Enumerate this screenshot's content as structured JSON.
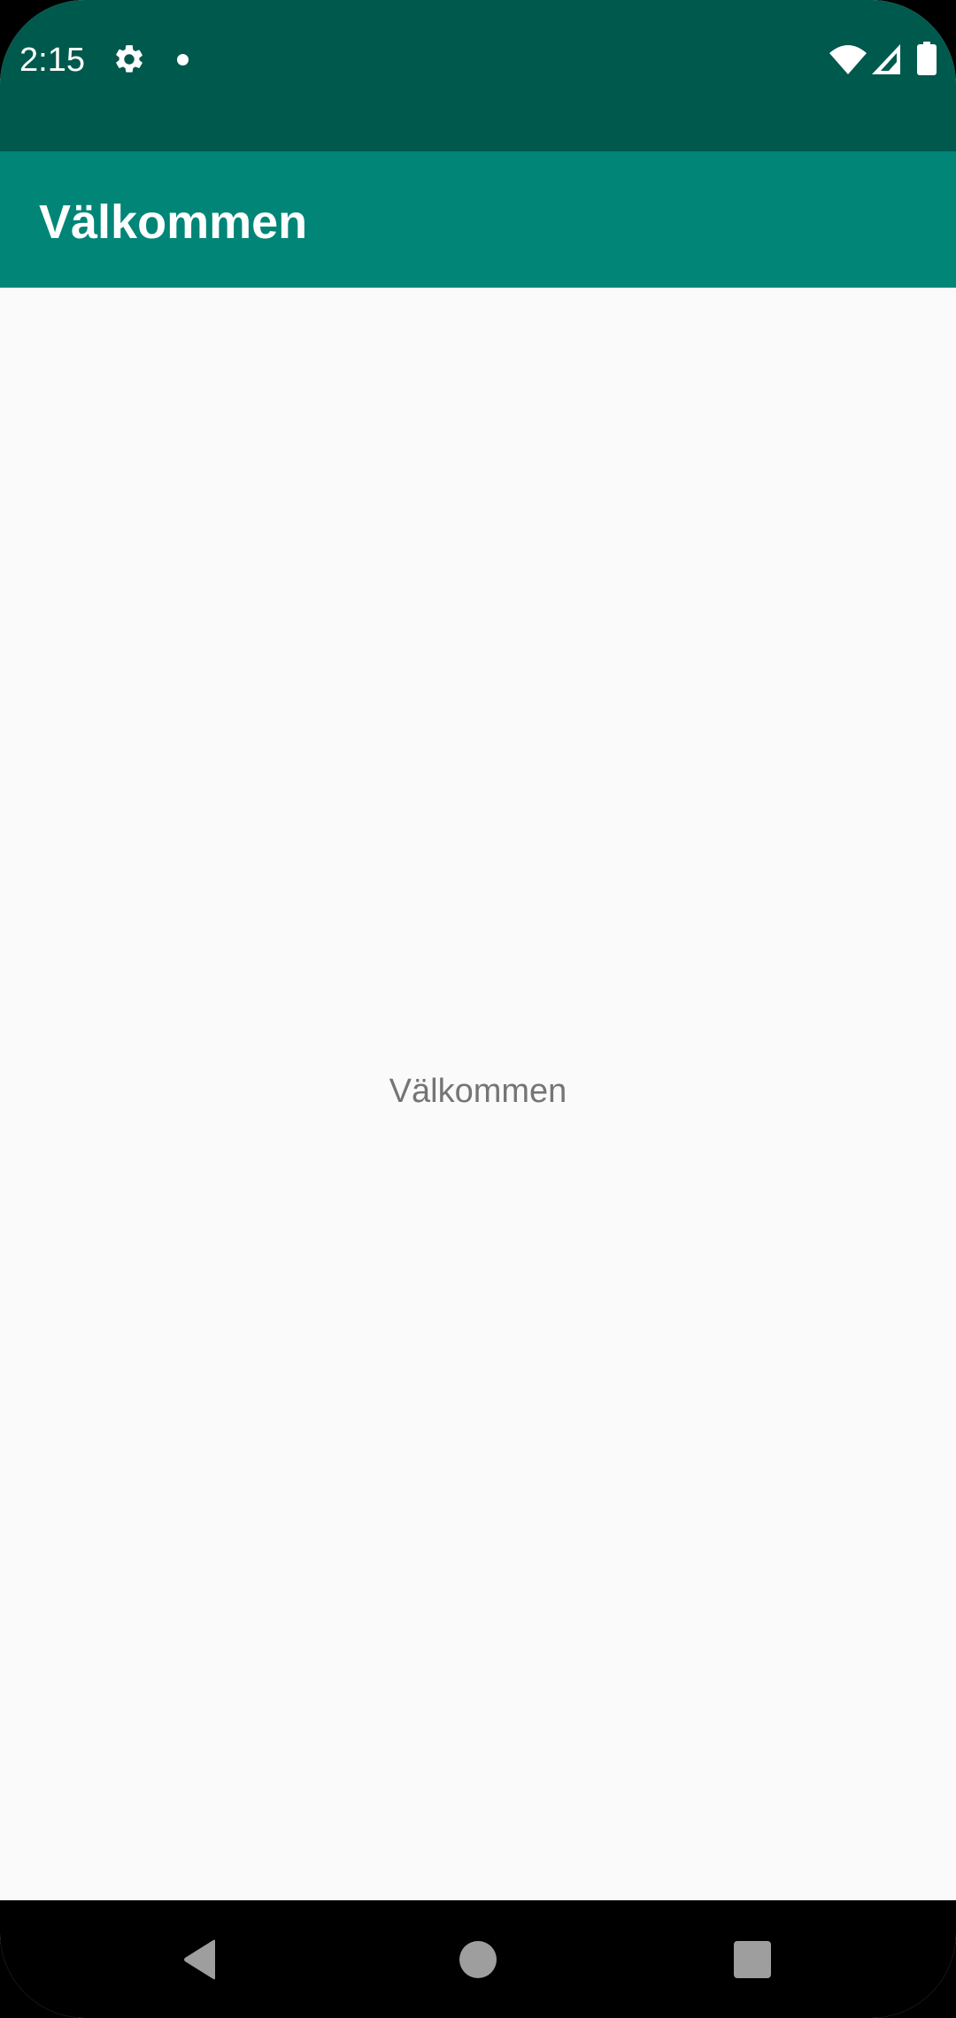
{
  "status_bar": {
    "time": "2:15",
    "icons": [
      "gear-icon",
      "notification-dot-icon",
      "wifi-icon",
      "cell-signal-icon",
      "battery-icon"
    ],
    "background": "#00594d"
  },
  "app_bar": {
    "title": "Välkommen",
    "background": "#008577"
  },
  "main": {
    "message": "Välkommen",
    "background": "#fafafa"
  },
  "nav_bar": {
    "icons": [
      "back-icon",
      "home-icon",
      "recents-icon"
    ]
  }
}
